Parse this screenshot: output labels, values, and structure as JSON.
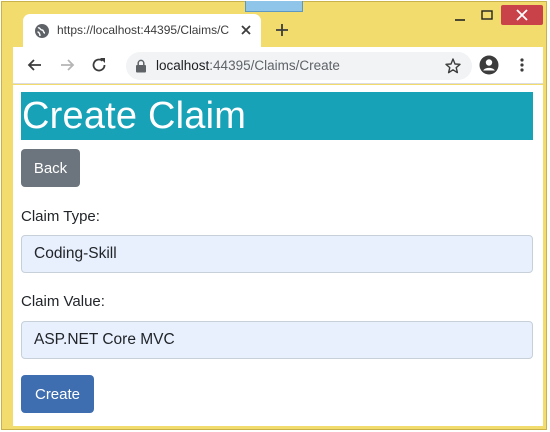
{
  "browser": {
    "tab_title": "https://localhost:44395/Claims/C",
    "url_host": "localhost",
    "url_path": ":44395/Claims/Create"
  },
  "page": {
    "heading": "Create Claim",
    "back_label": "Back",
    "claim_type_label": "Claim Type:",
    "claim_type_value": "Coding-Skill",
    "claim_value_label": "Claim Value:",
    "claim_value_value": "ASP.NET Core MVC",
    "create_label": "Create"
  },
  "colors": {
    "heading_bg": "#17a2b8",
    "back_button": "#6c757d",
    "create_button": "#3f6eb0",
    "window_frame": "#f2dc6e",
    "close_button": "#c9424a"
  }
}
